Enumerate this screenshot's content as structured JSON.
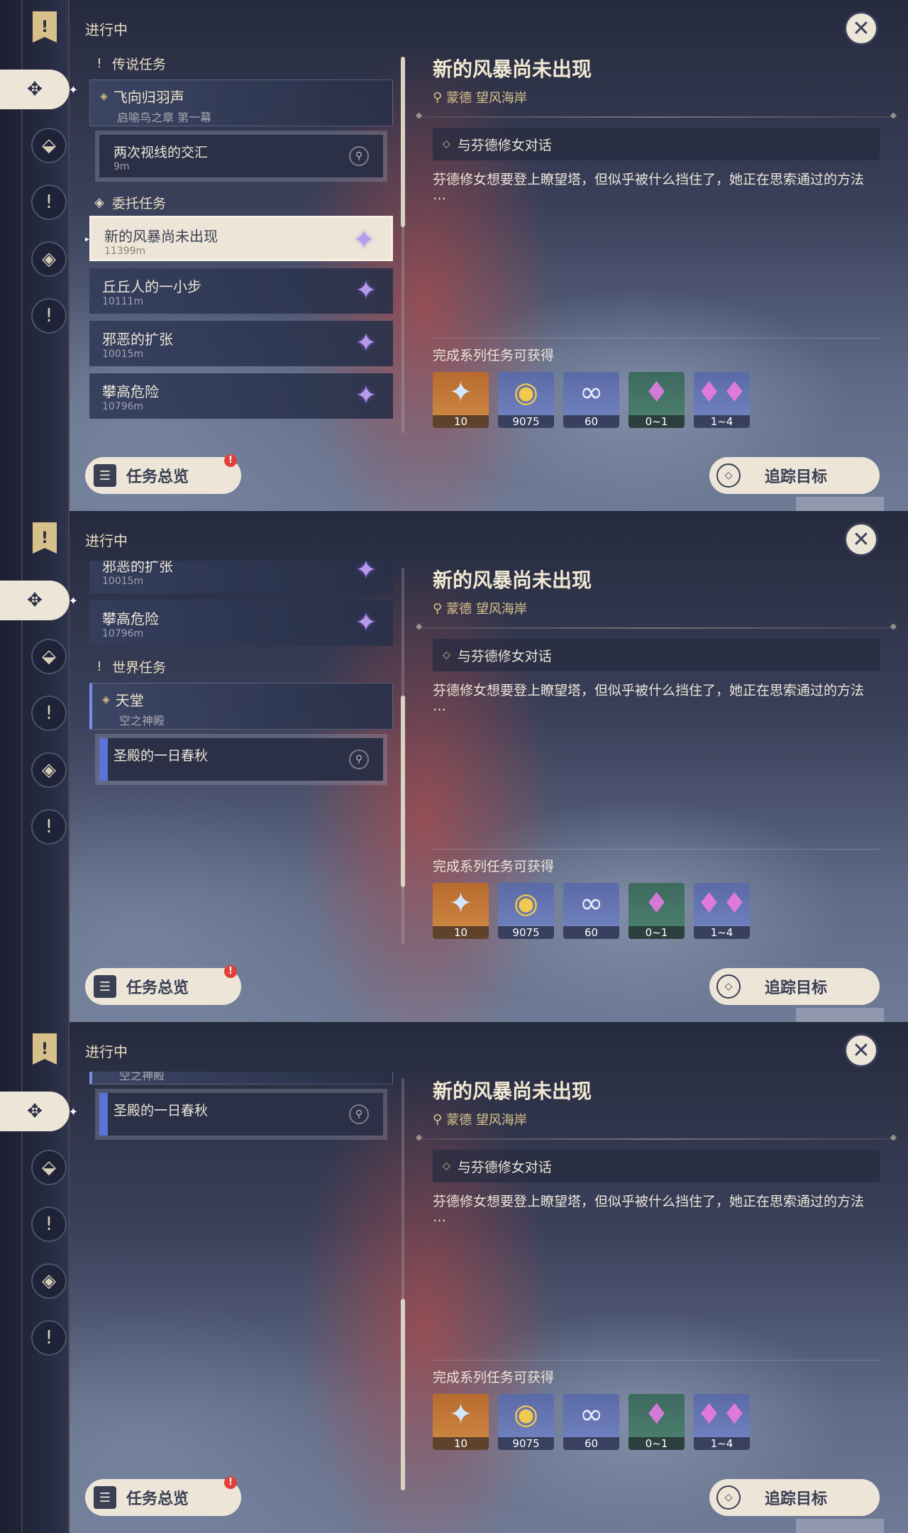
{
  "header": {
    "status": "进行中",
    "close_icon": "close-icon",
    "bookmark": "!"
  },
  "rail_icons": [
    "commission-icon",
    "archon-icon",
    "story-icon",
    "world-icon",
    "exclaim-icon"
  ],
  "categories": {
    "legend": "传说任务",
    "commission": "委托任务",
    "world": "世界任务"
  },
  "legend_main": {
    "title": "飞向归羽声",
    "subtitle": "启喻鸟之章 第一幕"
  },
  "legend_sub": {
    "title": "两次视线的交汇",
    "distance": "9m"
  },
  "tasks": [
    {
      "title": "新的风暴尚未出现",
      "distance": "11399m"
    },
    {
      "title": "丘丘人的一小步",
      "distance": "10111m"
    },
    {
      "title": "邪恶的扩张",
      "distance": "10015m"
    },
    {
      "title": "攀高危险",
      "distance": "10796m"
    }
  ],
  "world_main": {
    "title": "天堂",
    "subtitle": "空之神殿"
  },
  "world_sub": {
    "title": "圣殿的一日春秋"
  },
  "detail": {
    "title": "新的风暴尚未出现",
    "location": "蒙德 望风海岸",
    "objective": "与芬德修女对话",
    "description": "芬德修女想要登上瞭望塔，但似乎被什么挡住了，她正在思索通过的方法",
    "ellipsis": "…"
  },
  "rewards": {
    "title": "完成系列任务可获得",
    "items": [
      {
        "icon": "primogem-icon",
        "count": "10"
      },
      {
        "icon": "mora-icon",
        "count": "9075"
      },
      {
        "icon": "exp-icon",
        "count": "60"
      },
      {
        "icon": "crystal-icon",
        "count": "0~1"
      },
      {
        "icon": "crystal-cluster-icon",
        "count": "1~4"
      }
    ]
  },
  "buttons": {
    "overview": "任务总览",
    "overview_badge": "!",
    "track": "追踪目标"
  }
}
